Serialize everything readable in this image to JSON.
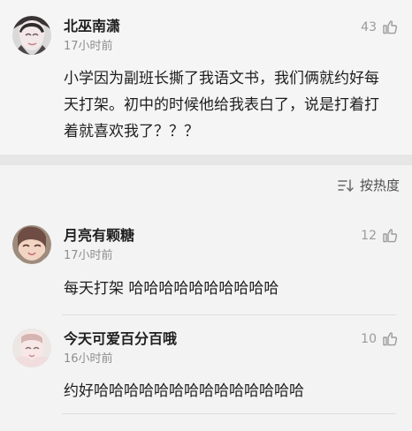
{
  "sort": {
    "label": "按热度",
    "icon": "sort-icon"
  },
  "comments": [
    {
      "username": "北巫南潇",
      "time": "17小时前",
      "likes": "43",
      "icon": "like-icon",
      "content": "小学因为副班长撕了我语文书，我们俩就约好每天打架。初中的时候他给我表白了，说是打着打着就喜欢我了？？？"
    },
    {
      "username": "月亮有颗糖",
      "time": "17小时前",
      "likes": "12",
      "icon": "like-icon",
      "content": "每天打架  哈哈哈哈哈哈哈哈哈哈"
    },
    {
      "username": "今天可爱百分百哦",
      "time": "16小时前",
      "likes": "10",
      "icon": "like-icon",
      "content": "约好哈哈哈哈哈哈哈哈哈哈哈哈哈哈"
    }
  ],
  "colors": {
    "background": "#f3f3f3",
    "text": "#1d1d1d",
    "muted": "#8e8e8e",
    "divider": "#dddddd",
    "separator": "#e6e6e6"
  }
}
